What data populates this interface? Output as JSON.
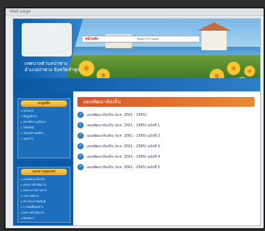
{
  "browser": {
    "title": "Web page"
  },
  "header": {
    "site_title": "เทศบาลตำบลป่าซาง",
    "site_subtitle": "อำเภอป่าซาง จังหวัดลำพูน",
    "crumb_tag": "หน้าหลัก",
    "crumb_text": "ข้อมูลการวางแผน"
  },
  "sidebar": {
    "box1_title": "เมนูหลัก",
    "box1_items": [
      "หน้าแรก",
      "ข้อมูลทั่วไป",
      "ประวัติความเป็นมา",
      "วิสัยทัศน์",
      "โครงสร้างองค์กร",
      "บุคลากร"
    ],
    "box2_title": "เอกสารเผยแพร่",
    "box2_items": [
      "แผนพัฒนาท้องถิ่น",
      "แผนการดำเนินงาน",
      "งบประมาณรายจ่าย",
      "ประกาศต่างๆ",
      "ข่าวประชาสัมพันธ์",
      "การจัดซื้อจัดจ้าง",
      "ผลการดำเนินงาน",
      "ติดต่อเรา"
    ]
  },
  "content": {
    "section_title": "แผนพัฒนาท้องถิ่น",
    "documents": [
      "แผนพัฒนาท้องถิ่น (พ.ศ. 2561 - 2565)",
      "แผนพัฒนาท้องถิ่น (พ.ศ. 2561 - 2565) ฉบับที่ 1",
      "แผนพัฒนาท้องถิ่น (พ.ศ. 2561 - 2565) ฉบับที่ 2",
      "แผนพัฒนาท้องถิ่น (พ.ศ. 2561 - 2565) ฉบับที่ 3",
      "แผนพัฒนาท้องถิ่น (พ.ศ. 2561 - 2565) ฉบับที่ 4",
      "แผนพัฒนาท้องถิ่น (พ.ศ. 2561 - 2565) ฉบับที่ 5"
    ]
  }
}
